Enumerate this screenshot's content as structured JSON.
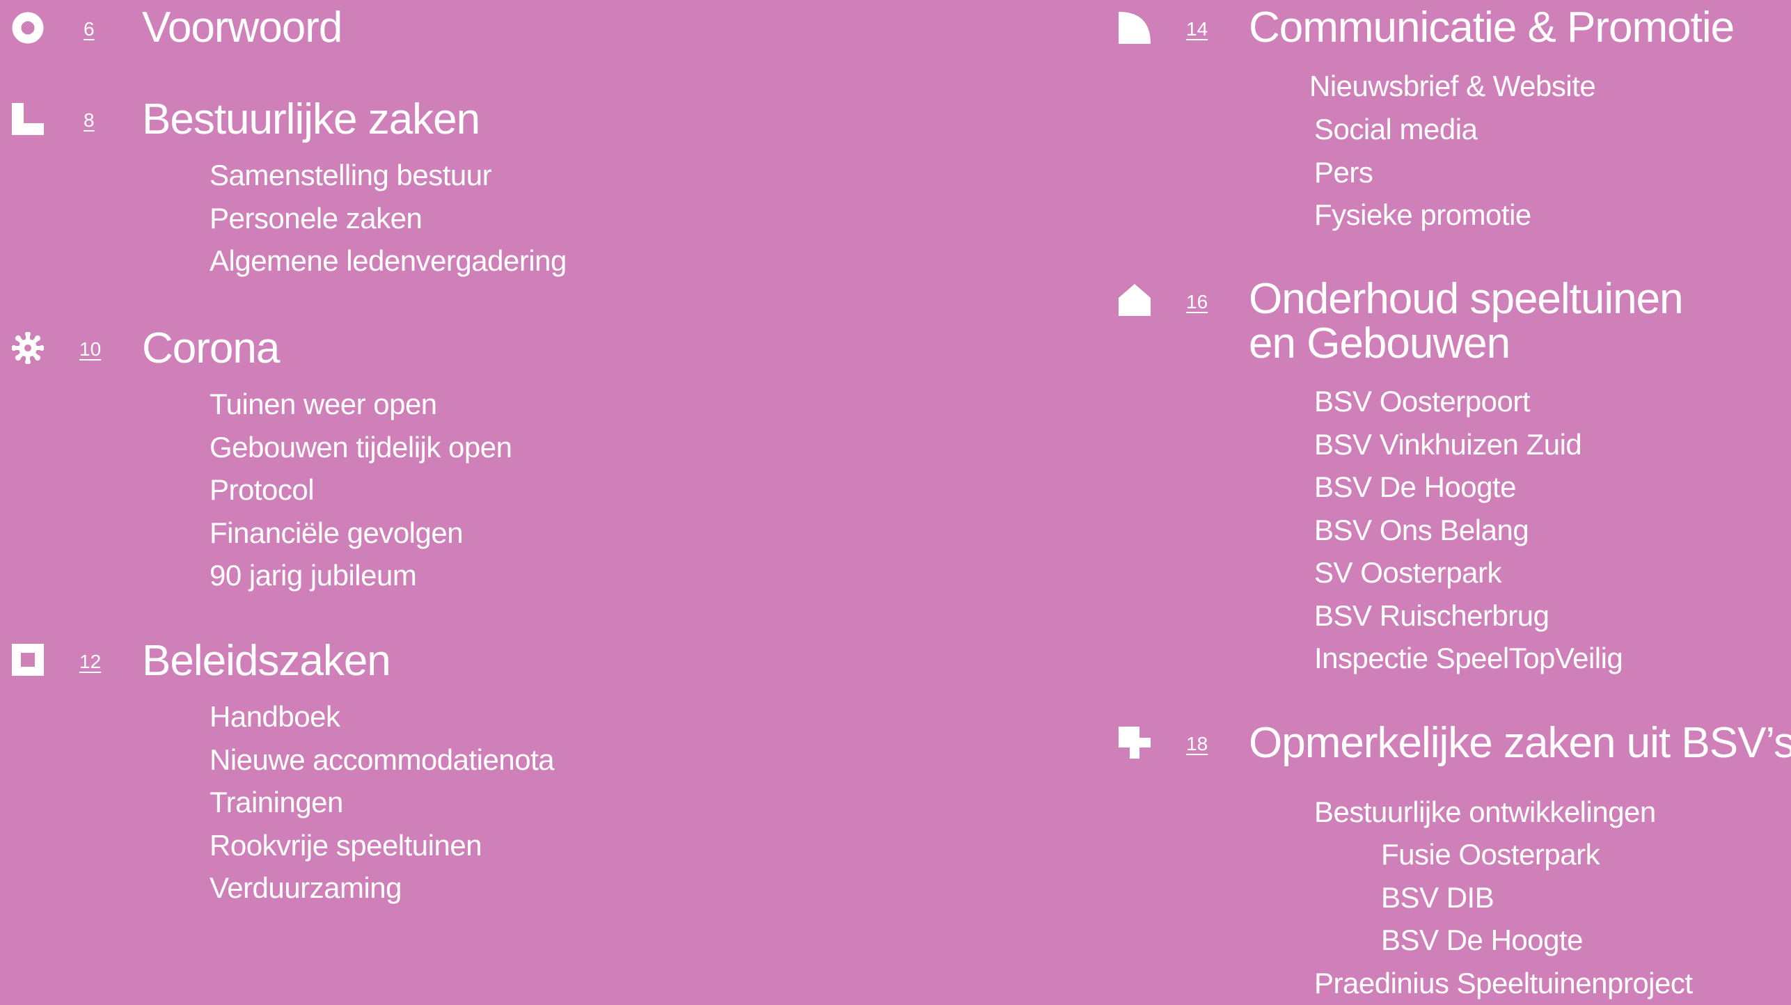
{
  "colors": {
    "background": "#d080b8",
    "text": "#ffffff"
  },
  "sections": [
    {
      "icon": "circle-ring-icon",
      "page": "6",
      "title": "Voorwoord",
      "items": []
    },
    {
      "icon": "l-shape-icon",
      "page": "8",
      "title": "Bestuurlijke zaken",
      "items": [
        "Samenstelling bestuur",
        "Personele zaken",
        "Algemene ledenvergadering"
      ]
    },
    {
      "icon": "virus-icon",
      "page": "10",
      "title": "Corona",
      "items": [
        "Tuinen weer open",
        "Gebouwen tijdelijk open",
        "Protocol",
        "Financiële gevolgen",
        "90 jarig jubileum"
      ]
    },
    {
      "icon": "square-frame-icon",
      "page": "12",
      "title": "Beleidszaken",
      "items": [
        "Handboek",
        "Nieuwe accommodatienota",
        "Trainingen",
        "Rookvrije speeltuinen",
        "Verduurzaming"
      ]
    },
    {
      "icon": "quarter-circle-icon",
      "page": "14",
      "title": "Communicatie & Promotie",
      "items": [
        "Nieuwsbrief & Website",
        "Social media",
        "Pers",
        "Fysieke promotie"
      ]
    },
    {
      "icon": "house-icon",
      "page": "16",
      "title": "Onderhoud speeltuinen",
      "title_line2": "en Gebouwen",
      "items": [
        "BSV Oosterpoort",
        "BSV Vinkhuizen Zuid",
        "BSV De Hoogte",
        "BSV Ons Belang",
        "SV Oosterpark",
        "BSV Ruischerbrug",
        "Inspectie SpeelTopVeilig"
      ]
    },
    {
      "icon": "puzzle-cross-icon",
      "page": "18",
      "title": "Opmerkelijke zaken uit BSV’s",
      "items": [
        "Bestuurlijke ontwikkelingen",
        "Praedinius Speeltuinenproject"
      ],
      "subitems": [
        "Fusie Oosterpark",
        "BSV DIB",
        "BSV De Hoogte"
      ]
    }
  ]
}
